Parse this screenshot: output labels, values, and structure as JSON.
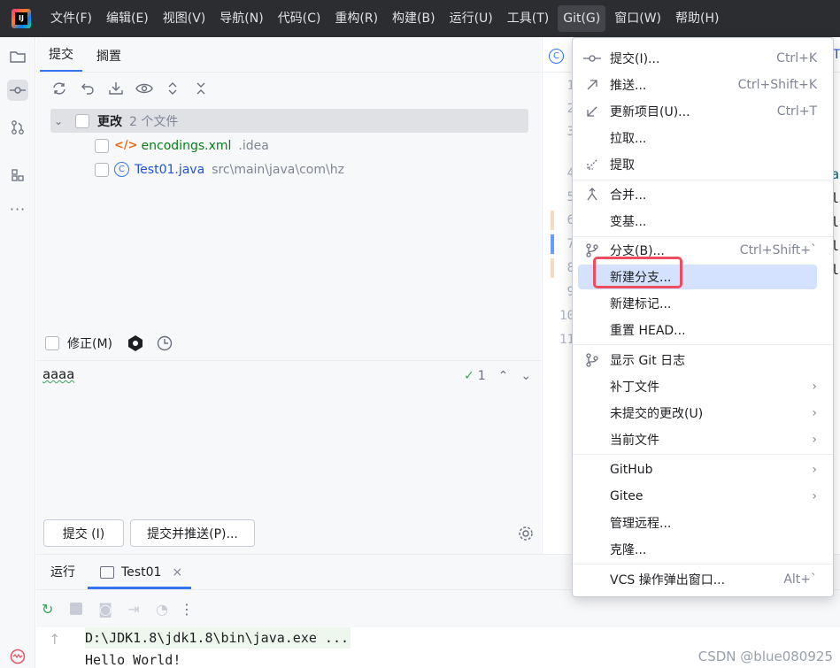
{
  "menubar": {
    "items": [
      "文件(F)",
      "编辑(E)",
      "视图(V)",
      "导航(N)",
      "代码(C)",
      "重构(R)",
      "构建(B)",
      "运行(U)",
      "工具(T)",
      "Git(G)",
      "窗口(W)",
      "帮助(H)"
    ]
  },
  "commit_panel": {
    "tabs": [
      "提交",
      "搁置"
    ],
    "changes_label": "更改",
    "changes_count": "2 个文件",
    "files": [
      {
        "name": "encodings.xml",
        "path": ".idea",
        "color": "#067d17"
      },
      {
        "name": "Test01.java",
        "path": "src\\main\\java\\com\\hz",
        "color": "#2155d5"
      }
    ],
    "amend_label": "修正(M)",
    "message": "aaaa",
    "check_count": "1",
    "commit_button": "提交 (I)",
    "commit_push_button": "提交并推送(P)..."
  },
  "editor": {
    "tab_initial": "T",
    "line_numbers": [
      "1",
      "2",
      "3",
      "4",
      "5",
      "6",
      "7",
      "8",
      "9",
      "10",
      "11"
    ],
    "code_fragments": [
      "ma",
      "tl",
      "tl",
      "tl",
      "tl"
    ]
  },
  "git_menu": {
    "items": [
      {
        "label": "提交(I)...",
        "shortcut": "Ctrl+K",
        "icon": "commit-icon"
      },
      {
        "label": "推送...",
        "shortcut": "Ctrl+Shift+K",
        "icon": "push-arrow-icon"
      },
      {
        "label": "更新项目(U)...",
        "shortcut": "Ctrl+T",
        "icon": "update-arrow-icon"
      },
      {
        "label": "拉取...",
        "shortcut": "",
        "icon": ""
      },
      {
        "label": "提取",
        "shortcut": "",
        "icon": "fetch-icon"
      },
      {
        "label": "合并...",
        "shortcut": "",
        "icon": "merge-icon"
      },
      {
        "label": "变基...",
        "shortcut": "",
        "icon": ""
      },
      {
        "label": "分支(B)...",
        "shortcut": "Ctrl+Shift+`",
        "icon": "branch-icon"
      },
      {
        "label": "新建分支...",
        "shortcut": "",
        "icon": ""
      },
      {
        "label": "新建标记...",
        "shortcut": "",
        "icon": ""
      },
      {
        "label": "重置 HEAD...",
        "shortcut": "",
        "icon": ""
      },
      {
        "label": "显示 Git 日志",
        "shortcut": "",
        "icon": "git-log-icon"
      },
      {
        "label": "补丁文件",
        "shortcut": "",
        "icon": "",
        "submenu": true
      },
      {
        "label": "未提交的更改(U)",
        "shortcut": "",
        "icon": "",
        "submenu": true
      },
      {
        "label": "当前文件",
        "shortcut": "",
        "icon": "",
        "submenu": true
      },
      {
        "label": "GitHub",
        "shortcut": "",
        "icon": "",
        "submenu": true
      },
      {
        "label": "Gitee",
        "shortcut": "",
        "icon": "",
        "submenu": true
      },
      {
        "label": "管理远程...",
        "shortcut": "",
        "icon": ""
      },
      {
        "label": "克隆...",
        "shortcut": "",
        "icon": ""
      },
      {
        "label": "VCS 操作弹出窗口...",
        "shortcut": "Alt+`",
        "icon": ""
      }
    ]
  },
  "bottom_panel": {
    "run_tab": "运行",
    "config_tab": "Test01",
    "console_line1": "D:\\JDK1.8\\jdk1.8\\bin\\java.exe ...",
    "console_line2": "Hello World!"
  },
  "watermark": "CSDN @blue080925"
}
